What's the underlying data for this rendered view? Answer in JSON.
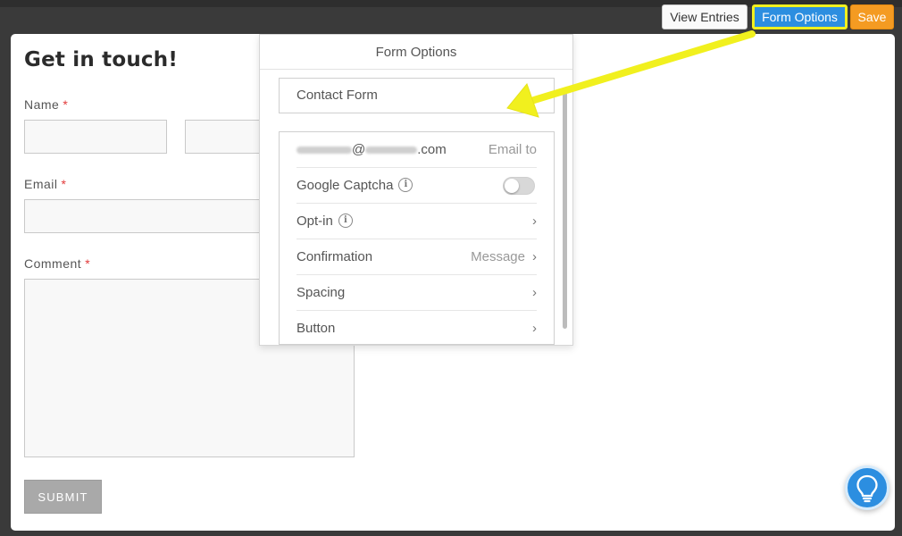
{
  "toolbar": {
    "view_entries_label": "View Entries",
    "form_options_label": "Form Options",
    "save_label": "Save"
  },
  "form": {
    "title": "Get in touch!",
    "name_label": "Name",
    "email_label": "Email",
    "comment_label": "Comment",
    "required_mark": "*",
    "submit_label": "SUBMIT"
  },
  "panel": {
    "title": "Form Options",
    "form_name": "Contact Form",
    "rows": [
      {
        "label": "@",
        "label_suffix": ".com",
        "right": "Email to"
      },
      {
        "label": "Google Captcha",
        "info": "i",
        "toggle_on": false
      },
      {
        "label": "Opt-in",
        "info": "i",
        "chevron": "›"
      },
      {
        "label": "Confirmation",
        "right": "Message",
        "chevron": "›"
      },
      {
        "label": "Spacing",
        "chevron": "›"
      },
      {
        "label": "Button",
        "chevron": "›"
      }
    ]
  },
  "icons": {
    "help": "lightbulb-icon",
    "arrow": "highlight-arrow"
  },
  "colors": {
    "accent_blue": "#2c8ee0",
    "save_orange": "#f49b22",
    "highlight_yellow": "#f1f01e",
    "required_red": "#e23b3b"
  }
}
